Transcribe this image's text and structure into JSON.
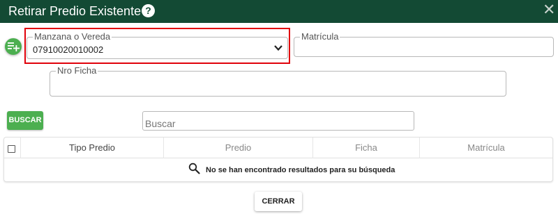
{
  "dialog": {
    "title": "Retirar Predio Existente",
    "help_glyph": "?",
    "close_glyph": "✕"
  },
  "form": {
    "manzana": {
      "label": "Manzana o Vereda",
      "value": "07910020010002"
    },
    "matricula": {
      "label": "Matrícula",
      "value": ""
    },
    "nro_ficha": {
      "label": "Nro Ficha",
      "value": ""
    }
  },
  "search": {
    "button_label": "BUSCAR",
    "placeholder": "Buscar"
  },
  "table": {
    "columns": [
      "Tipo Predio",
      "Predio",
      "Ficha",
      "Matrícula"
    ],
    "empty_message": "No se han encontrado resultados para su búsqueda"
  },
  "footer": {
    "close_label": "CERRAR"
  },
  "colors": {
    "header_bg": "#134a34",
    "accent_green": "#4caf50",
    "highlight_red": "#e0000a"
  },
  "icons": {
    "add": "playlist-add-icon",
    "help": "help-circle-icon",
    "close": "close-icon",
    "dropdown": "chevron-down-icon",
    "search": "magnifier-icon"
  }
}
